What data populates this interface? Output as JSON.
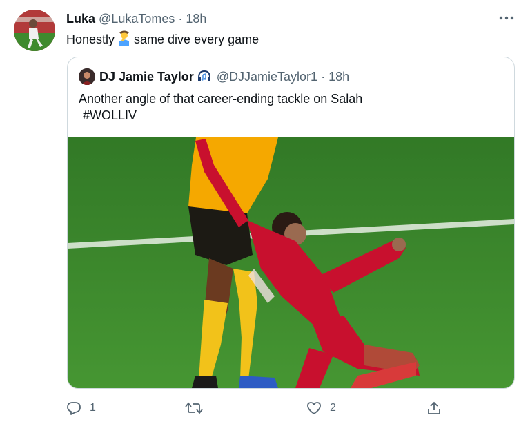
{
  "tweet": {
    "display_name": "Luka",
    "handle": "@LukaTomes",
    "separator": "·",
    "time": "18h",
    "text_before": "Honestly",
    "emoji": "man-facepalming",
    "text_after": "same dive every game"
  },
  "quoted_tweet": {
    "display_name": "DJ Jamie Taylor",
    "badge_icon": "headphones-music-icon",
    "handle": "@DJJamieTaylor1",
    "separator": "·",
    "time": "18h",
    "text_line1": "Another angle of that career-ending tackle on Salah",
    "hashtag": "#WOLLIV"
  },
  "actions": {
    "reply_count": "1",
    "retweet_count": "",
    "like_count": "2"
  },
  "colors": {
    "text": "#0f1419",
    "muted": "#536471",
    "border": "#cfd9de",
    "pitch": "#3f8a2e",
    "wolves_gold": "#f5a800",
    "liverpool_red": "#c8102e"
  }
}
